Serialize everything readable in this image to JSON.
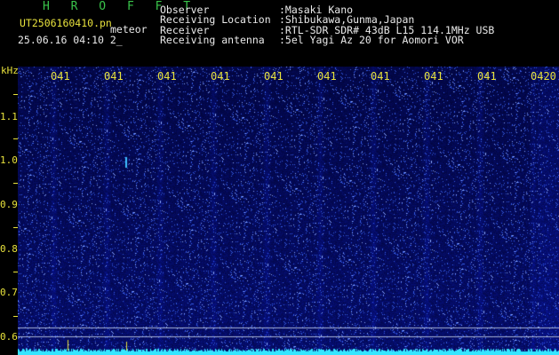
{
  "header": {
    "brand": "H R O F F T",
    "filename": "UT2506160410.pn",
    "kind": "meteor",
    "stamp": "25.06.16 04:10     2_"
  },
  "station": {
    "labels": [
      "Observer",
      "Receiving Location",
      "Receiver",
      "Receiving antenna"
    ],
    "values": [
      ":Masaki Kano",
      ":Shibukawa,Gunma,Japan",
      ":RTL-SDR SDR# 43dB L15 114.1MHz USB",
      ":5el Yagi Az 20 for Aomori VOR"
    ]
  },
  "axis": {
    "unit": "kHz",
    "ticks": [
      "1.1",
      "1.0",
      "0.9",
      "0.8",
      "0.7",
      "0.6"
    ],
    "time_marks": [
      "041",
      "041",
      "041",
      "041",
      "041",
      "041",
      "041",
      "041",
      "041",
      "0420"
    ]
  },
  "colors": {
    "background": "#000000",
    "noise_base": "#0c1a8c",
    "noise_bright": "#4a86ff",
    "trace": "#35e6ff",
    "label": "#e8e23d"
  }
}
